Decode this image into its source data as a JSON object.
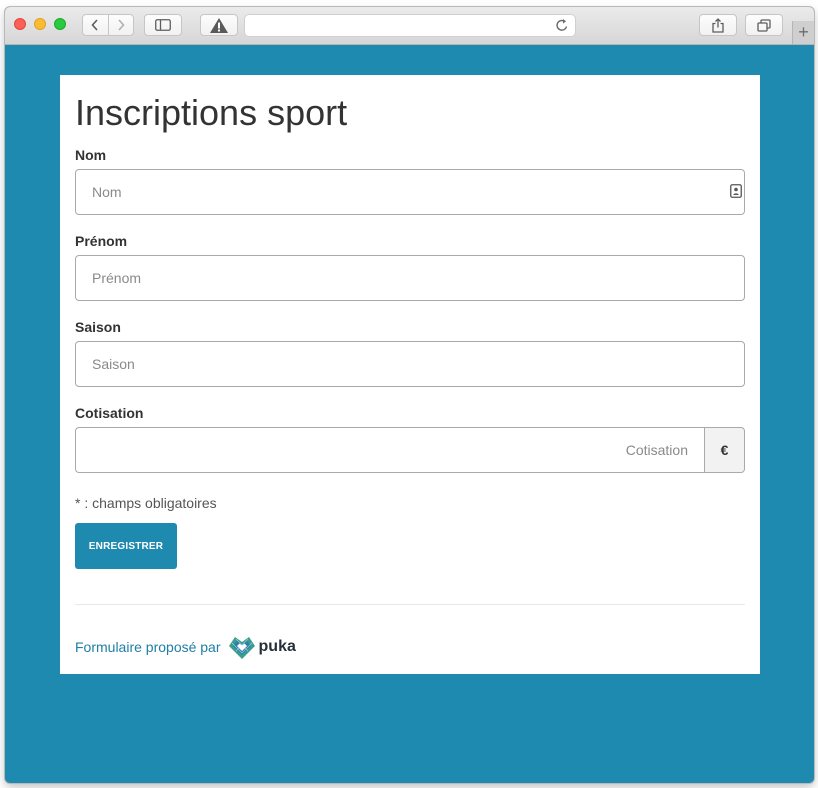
{
  "form": {
    "title": "Inscriptions sport",
    "fields": {
      "nom": {
        "label": "Nom",
        "placeholder": "Nom",
        "value": ""
      },
      "prenom": {
        "label": "Prénom",
        "placeholder": "Prénom",
        "value": ""
      },
      "saison": {
        "label": "Saison",
        "placeholder": "Saison",
        "value": ""
      },
      "cotisation": {
        "label": "Cotisation",
        "placeholder": "Cotisation",
        "value": "",
        "currency": "€"
      }
    },
    "required_note": "* : champs obligatoires",
    "submit_label": "ENREGISTRER"
  },
  "footer": {
    "text": "Formulaire proposé par",
    "brand": "puka"
  },
  "colors": {
    "page_background": "#1f8aaf",
    "button": "#1f8aaf",
    "footer_link": "#1f7ea5"
  },
  "icons": [
    "back-icon",
    "forward-icon",
    "sidebar-icon",
    "warning-icon",
    "reload-icon",
    "share-icon",
    "tabs-icon",
    "new-tab-icon",
    "contact-card-icon",
    "puka-logo-icon"
  ]
}
